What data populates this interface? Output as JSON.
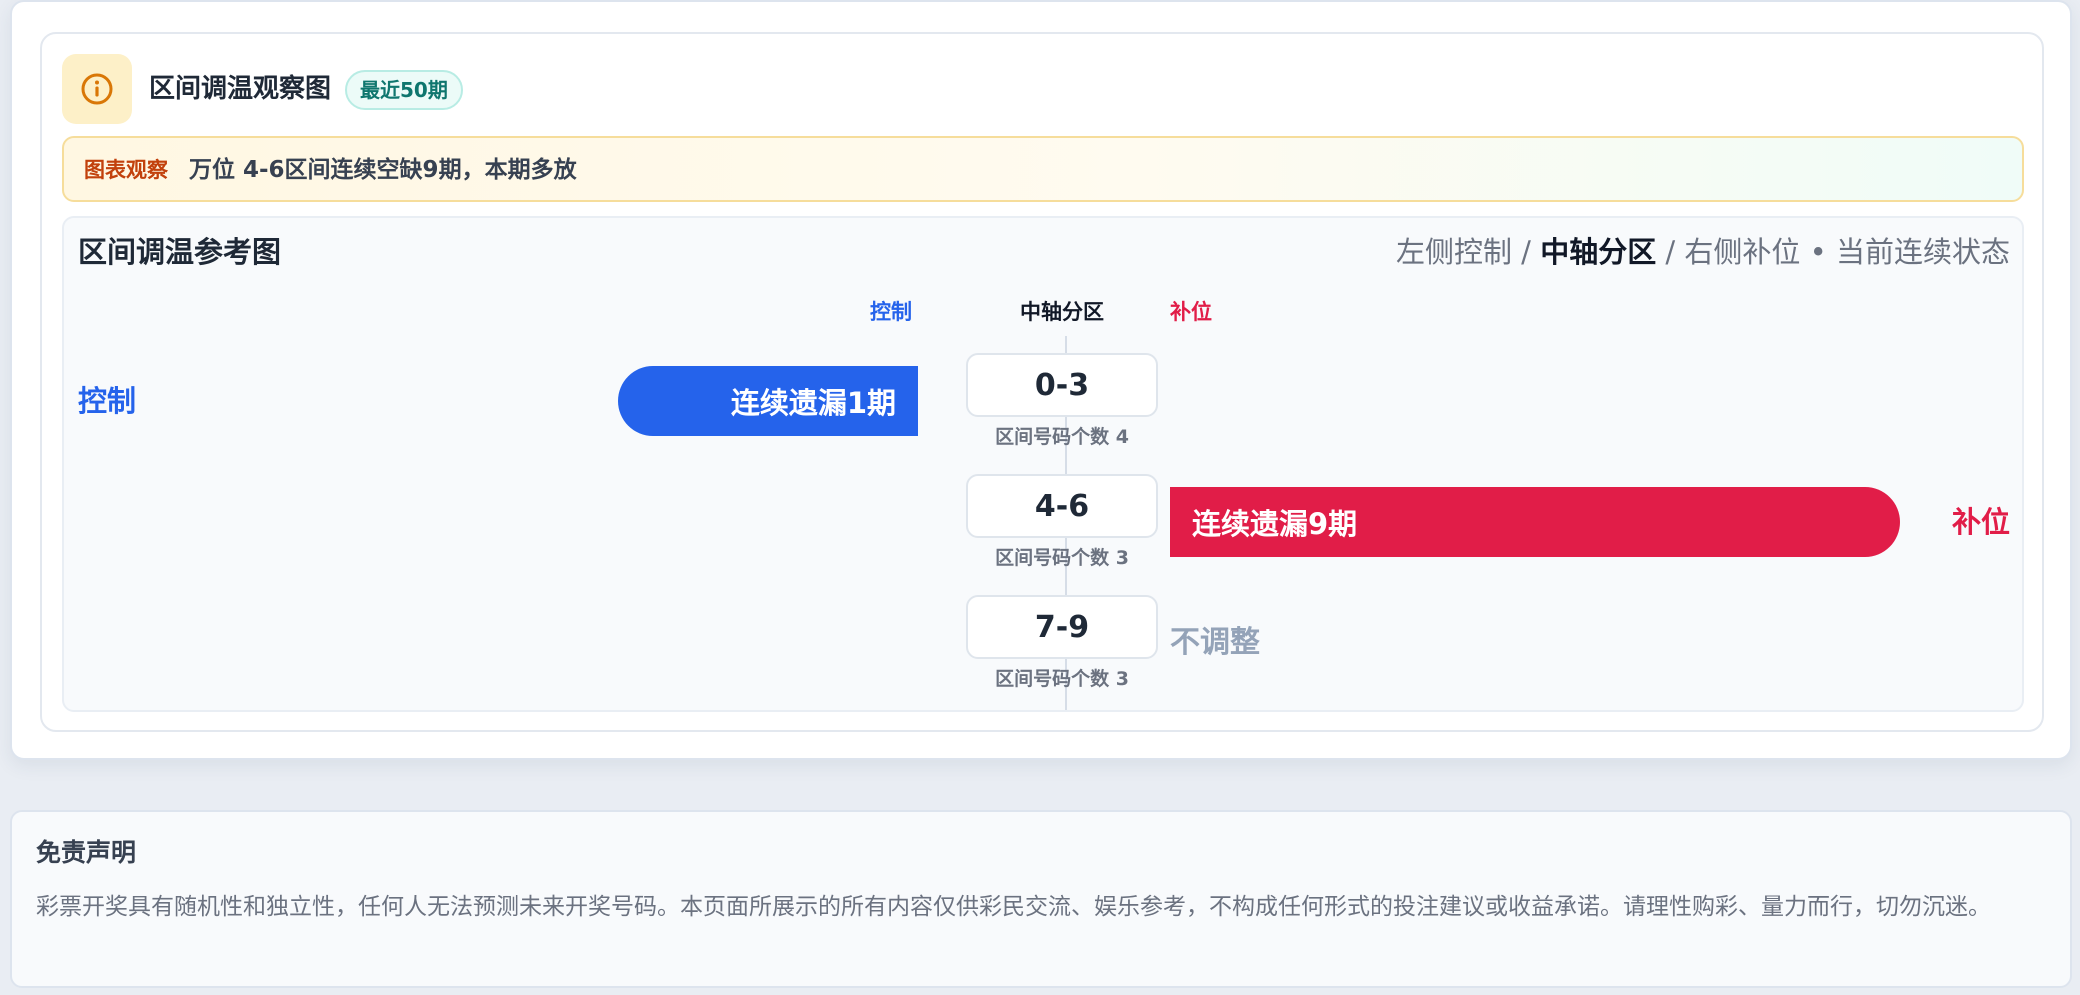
{
  "header": {
    "icon": "info-icon",
    "title": "区间调温观察图",
    "badge": "最近50期"
  },
  "observation": {
    "label": "图表观察",
    "text": "万位 4-6区间连续空缺9期，本期多放"
  },
  "chart": {
    "title": "区间调温参考图",
    "legend": {
      "left": "左侧控制",
      "sep1": " / ",
      "center": "中轴分区",
      "sep2": " / ",
      "right": "右侧补位",
      "dot": " • ",
      "state": "当前连续状态"
    },
    "column_heads": {
      "left": "控制",
      "center": "中轴分区",
      "right": "补位"
    }
  },
  "chart_data": {
    "type": "bar",
    "categories": [
      "0-3",
      "4-6",
      "7-9"
    ],
    "series": [
      {
        "name": "控制",
        "values": [
          1,
          0,
          0
        ]
      },
      {
        "name": "补位",
        "values": [
          0,
          9,
          0
        ]
      }
    ],
    "max_streak": 9,
    "rows": [
      {
        "zone": "0-3",
        "count_label": "区间号码个数 4",
        "side": "left",
        "streak": 1,
        "bar_text": "连续遗漏1期",
        "side_label": "控制"
      },
      {
        "zone": "4-6",
        "count_label": "区间号码个数 3",
        "side": "right",
        "streak": 9,
        "bar_text": "连续遗漏9期",
        "side_label": "补位"
      },
      {
        "zone": "7-9",
        "count_label": "区间号码个数 3",
        "side": "none",
        "streak": 0,
        "bar_text": "",
        "side_label": "",
        "none_text": "不调整"
      }
    ],
    "colors": {
      "control": "#2563eb",
      "fill": "#e11d48",
      "neutral": "#94a3b8"
    }
  },
  "disclaimer": {
    "title": "免责声明",
    "text": "彩票开奖具有随机性和独立性，任何人无法预测未来开奖号码。本页面所展示的所有内容仅供彩民交流、娱乐参考，不构成任何形式的投注建议或收益承诺。请理性购彩、量力而行，切勿沉迷。"
  }
}
